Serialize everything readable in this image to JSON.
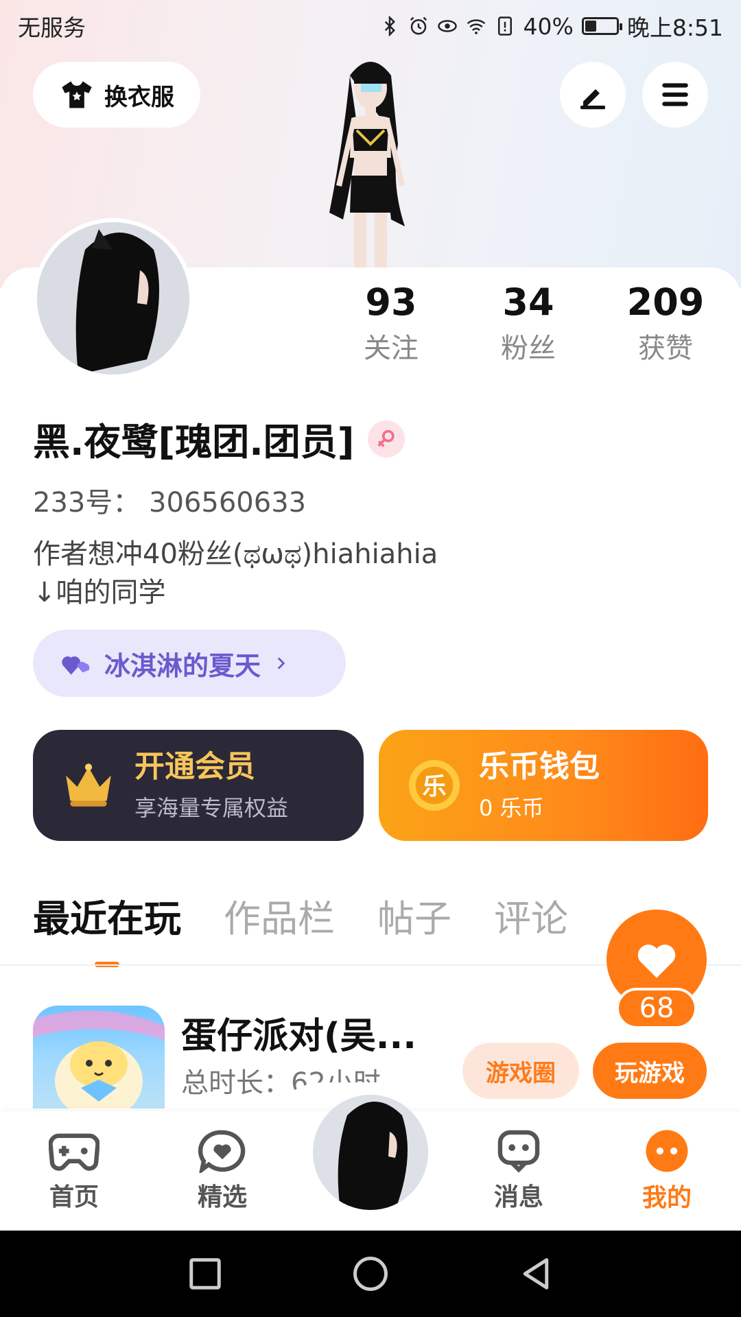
{
  "status_bar": {
    "carrier": "无服务",
    "battery": "40%",
    "battery_level": 0.4,
    "time": "晚上8:51"
  },
  "header": {
    "outfit_button": "换衣服",
    "edit_icon": "pen-icon",
    "menu_icon": "menu-icon"
  },
  "profile": {
    "stats": [
      {
        "value": "93",
        "label": "关注"
      },
      {
        "value": "34",
        "label": "粉丝"
      },
      {
        "value": "209",
        "label": "获赞"
      }
    ],
    "name": "黑.夜鹭[瑰团.团员]",
    "gender_icon": "female-icon",
    "uid": "233号： 306560633",
    "bio_line1": "作者想冲40粉丝(ಥωಥ)hiahiahia",
    "bio_line2": "↓咱的同学",
    "tag": "冰淇淋的夏天"
  },
  "cards": {
    "vip_title": "开通会员",
    "vip_sub": "享海量专属权益",
    "wallet_title": "乐币钱包",
    "wallet_sub": "0 乐币",
    "coin_char": "乐"
  },
  "tabs": [
    "最近在玩",
    "作品栏",
    "帖子",
    "评论"
  ],
  "recent_game": {
    "name": "蛋仔派对(吴...",
    "playtime": "总时长：62小时",
    "circle_button": "游戏圈",
    "play_button": "玩游戏"
  },
  "like": {
    "count": "68"
  },
  "bottom_nav": [
    {
      "label": "首页",
      "icon": "gamepad-icon"
    },
    {
      "label": "精选",
      "icon": "heart-bubble-icon"
    },
    {
      "label": "消息",
      "icon": "chat-icon"
    },
    {
      "label": "我的",
      "icon": "profile-face-icon"
    }
  ],
  "colors": {
    "accent": "#ff7a14",
    "vip_gold": "#f7c55a",
    "tag_purple": "#6a5acd"
  }
}
